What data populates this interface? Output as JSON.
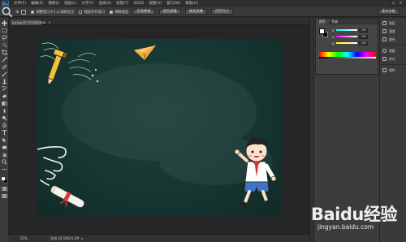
{
  "app": {
    "logo": "Ps"
  },
  "menubar": {
    "items": [
      "文件(F)",
      "编辑(E)",
      "图像(I)",
      "图层(L)",
      "文字(Y)",
      "选择(S)",
      "滤镜(T)",
      "3D(D)",
      "视图(V)",
      "窗口(W)",
      "帮助(H)"
    ],
    "window_controls": [
      "–",
      "▫",
      "×"
    ]
  },
  "options_bar": {
    "zoom_symbol": "⊕",
    "checkboxes": [
      {
        "label": "调整窗口大小以满屏显示",
        "checked": true
      },
      {
        "label": "缩放所有窗口",
        "checked": false
      },
      {
        "label": "细微缩放",
        "checked": true
      }
    ],
    "buttons": [
      "实际像素",
      "适合屏幕",
      "填充屏幕",
      "打印尺寸"
    ],
    "workspace": "基本功能"
  },
  "document": {
    "tab_label": "bg.jpg @ 25%(RGB/8)",
    "tab_close": "×"
  },
  "statusbar": {
    "zoom": "25%",
    "doc_info": "文档:24.1M/24.1M",
    "arrow": "▸"
  },
  "color_panel": {
    "tabs": [
      "颜色",
      "色板"
    ],
    "sliders": [
      {
        "label": "R",
        "value": "255",
        "from": "#00ffff",
        "to": "#ffffff"
      },
      {
        "label": "G",
        "value": "255",
        "from": "#ff00ff",
        "to": "#ffffff"
      },
      {
        "label": "B",
        "value": "255",
        "from": "#ffff00",
        "to": "#ffffff"
      }
    ]
  },
  "dock": {
    "items": [
      "图层",
      "通道",
      "路径",
      "调整",
      "样式",
      "属性"
    ]
  },
  "watermark": {
    "brand": "Baidu经验",
    "url": "jingyan.baidu.com"
  },
  "colors": {
    "chalkboard": "#163631",
    "paper_plane": "#f2a93b",
    "pencil": "#f5c23c",
    "shirt_tie": "#d62d2d",
    "shorts": "#3f74c4"
  }
}
